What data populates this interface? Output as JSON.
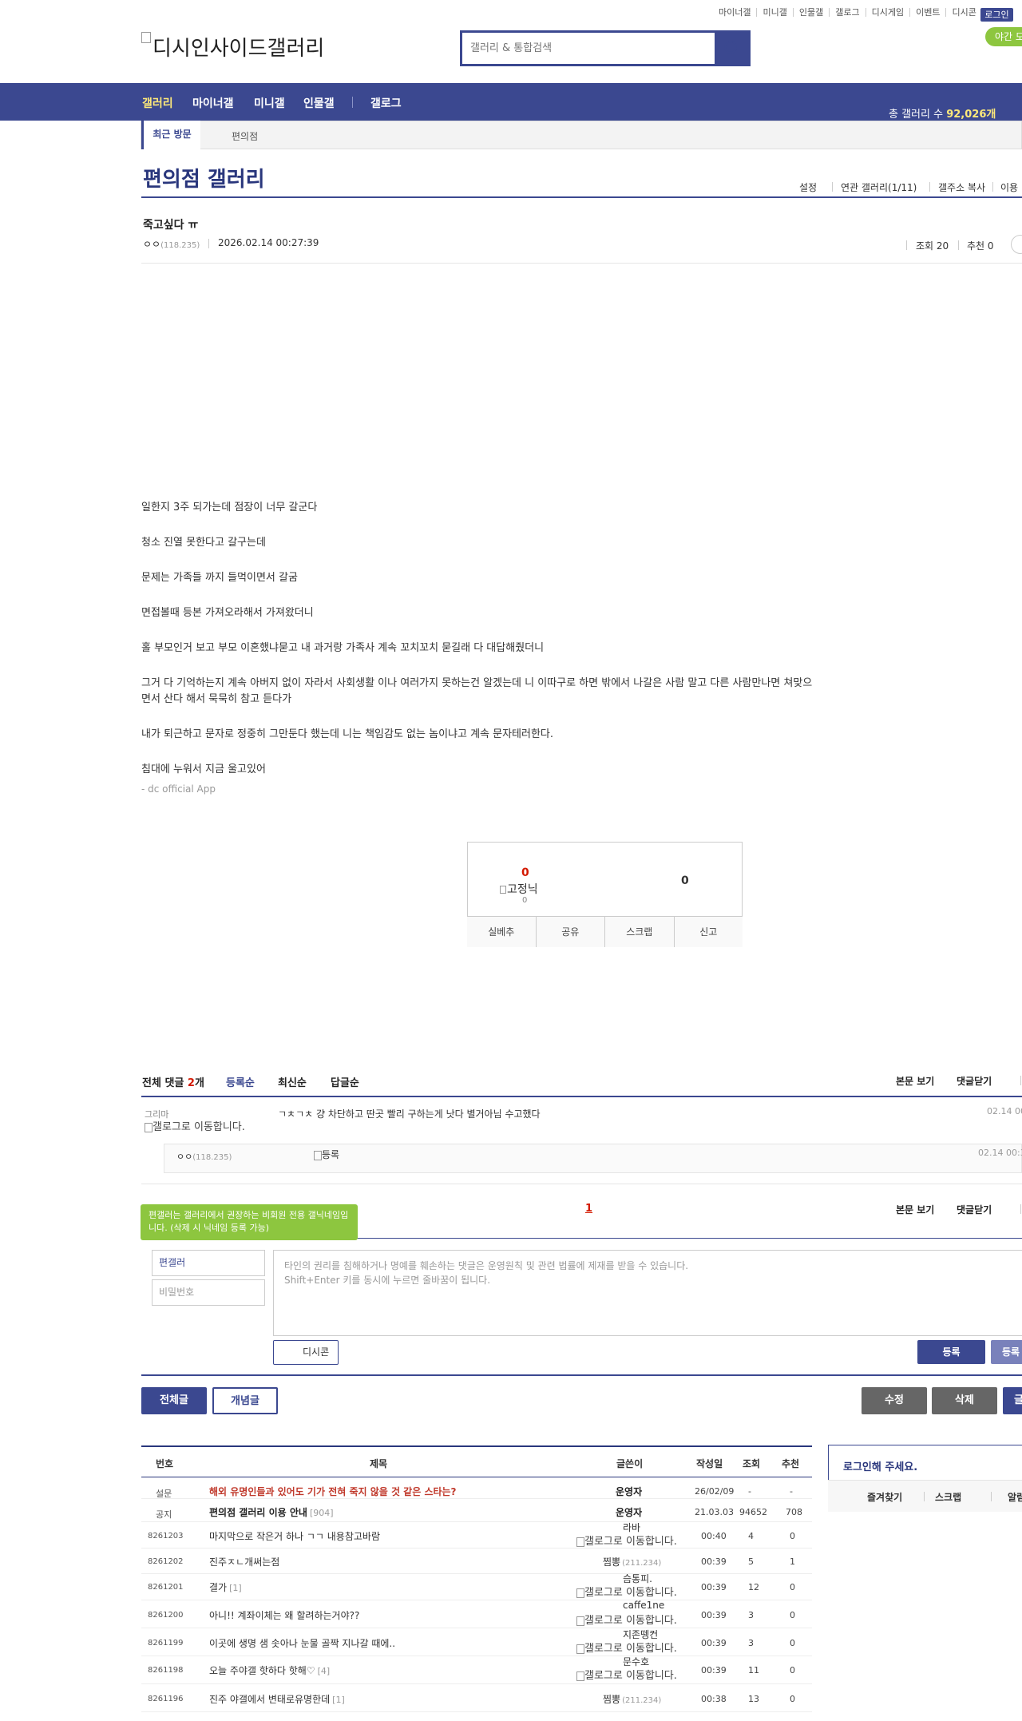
{
  "top_menu": [
    "마이너갤",
    "미니갤",
    "인물갤",
    "갤로그",
    "디시게임",
    "이벤트",
    "디시콘"
  ],
  "login_label": "로그인",
  "night_mode_label": "야간 모드",
  "logo_alt": "디시인사이드갤러리",
  "search": {
    "placeholder": "갤러리 & 통합검색"
  },
  "nav": {
    "items": [
      "갤러리",
      "마이너갤",
      "미니갤",
      "인물갤",
      "갤로그"
    ],
    "total_prefix": "총 갤러리 수",
    "total_value": "92,026개"
  },
  "recent": {
    "label": "최근 방문",
    "items": [
      "편의점"
    ]
  },
  "gallery": {
    "title": "편의점 갤러리",
    "menu": [
      "설정",
      "연관 갤러리(1/11)",
      "갤주소 복사",
      "이용"
    ]
  },
  "post": {
    "title": "죽고싶다 ㅠ",
    "author": "ㅇㅇ",
    "ip": "(118.235)",
    "date": "2026.02.14 00:27:39",
    "views_label": "조회 20",
    "recommend_label": "추천 0",
    "paragraphs": [
      "일한지 3주 되가는데 점장이 너무 갈군다",
      "청소 진열 못한다고 갈구는데",
      "문제는 가족들 까지 들먹이면서 갈굼",
      "면접볼때 등본 가져오라해서 가져왔더니",
      "홀 부모인거 보고 부모 이혼했냐묻고 내 과거랑 가족사 계속 꼬치꼬치 묻길래 다 대답해줬더니",
      "그거 다 기억하는지 계속 아버지 없이 자라서 사회생활 이나 여러가지 못하는건 알겠는데 니 이따구로 하면 밖에서 나갈은 사람 말고 다른 사람만나면 쳐맞으",
      "면서 산다 해서 묵묵히 참고 듣다가",
      "내가 퇴근하고 문자로 정중히 그만둔다 했는데  니는 책임감도 없는 놈이냐고 계속 문자테러한다.",
      "침대에 누워서 지금 울고있어"
    ],
    "app_sign": "- dc official App"
  },
  "recommend": {
    "up_count": "0",
    "fixed_label": "고정닉",
    "fixed_count": "0",
    "down_count": "0",
    "buttons": [
      "실베추",
      "공유",
      "스크랩",
      "신고"
    ]
  },
  "comments": {
    "total_label": "전체 댓글",
    "total_count": "2",
    "total_unit": "개",
    "sorts": [
      "등록순",
      "최신순",
      "답글순"
    ],
    "view_body": "본문 보기",
    "close": "댓글닫기",
    "items": [
      {
        "author": "그리마",
        "img_alt": "갤로그로 이동합니다.",
        "text": "ㄱㅊㄱㅊ 걍 차단하고 딴곳 빨리 구하는게 낫다 별거아님 수고했다",
        "date": "02.14 00:"
      },
      {
        "author": "ㅇㅇ",
        "ip": "(118.235)",
        "img_alt": "등록",
        "date": "02.14 00:3"
      }
    ],
    "page": "1"
  },
  "write": {
    "tip": "편갤러는 갤러리에서 권장하는 비회원 전용 갤닉네임입니다. (삭제 시 닉네임 등록 가능)",
    "nick": "편갤러",
    "pw_placeholder": "비밀번호",
    "notice1": "타인의 권리를 침해하거나 명예를 훼손하는 댓글은 운영원칙 및 관련 법률에 제재를 받을 수 있습니다.",
    "notice2": "Shift+Enter 키를 동시에 누르면 줄바꿈이 됩니다.",
    "dccon": "디시콘",
    "submit": "등록",
    "submit2": "등록"
  },
  "actions": {
    "all": "전체글",
    "concept": "개념글",
    "edit": "수정",
    "delete": "삭제",
    "write": "글"
  },
  "list": {
    "headers": [
      "번호",
      "제목",
      "글쓴이",
      "작성일",
      "조회",
      "추천"
    ],
    "rows": [
      {
        "no": "설문",
        "title": "해외 유명인들과 있어도 기가 전혀 죽지 않을 것 같은 스타는?",
        "author": "운영자",
        "date": "26/02/09",
        "views": "-",
        "rec": "-",
        "style": "survey"
      },
      {
        "no": "공지",
        "title": "편의점 갤러리 이용 안내",
        "count": "[904]",
        "author": "운영자",
        "date": "21.03.03",
        "views": "94652",
        "rec": "708",
        "style": "notice"
      },
      {
        "no": "8261203",
        "title": "마지막으로 작은거 하나 ㄱㄱ 내용참고바람",
        "author": "라바",
        "img": "갤로그로 이동합니다.",
        "date": "00:40",
        "views": "4",
        "rec": "0"
      },
      {
        "no": "8261202",
        "title": "진주ㅈㄴ개써는점",
        "author": "찜뽕",
        "ip": "(211.234)",
        "date": "00:39",
        "views": "5",
        "rec": "1"
      },
      {
        "no": "8261201",
        "title": "결가",
        "count": "[1]",
        "author": "슴통피.",
        "img": "갤로그로 이동합니다.",
        "date": "00:39",
        "views": "12",
        "rec": "0"
      },
      {
        "no": "8261200",
        "title": "아니!! 계좌이체는 왜 할려하는거야??",
        "author": "caffe1ne",
        "img": "갤로그로 이동합니다.",
        "date": "00:39",
        "views": "3",
        "rec": "0"
      },
      {
        "no": "8261199",
        "title": "이곳에 생명 샘 솟아나 눈물 골짝 지나갈 때에..",
        "author": "지존뗑컨",
        "img": "갤로그로 이동합니다.",
        "date": "00:39",
        "views": "3",
        "rec": "0"
      },
      {
        "no": "8261198",
        "title": "오늘 주야갤 핫하다 핫해♡",
        "count": "[4]",
        "author": "문수호",
        "img": "갤로그로 이동합니다.",
        "date": "00:39",
        "views": "11",
        "rec": "0"
      },
      {
        "no": "8261196",
        "title": "진주 야갤에서 변태로유명한데",
        "count": "[1]",
        "author": "찜뽕",
        "ip": "(211.234)",
        "date": "00:38",
        "views": "13",
        "rec": "0"
      }
    ]
  },
  "sidebox": {
    "title": "로그인해 주세요.",
    "items": [
      "즐겨찾기",
      "스크랩",
      "알림"
    ]
  },
  "colors": {
    "brand": "#3b4890",
    "accent_green": "#8dc63f",
    "highlight_yellow": "#fde97a",
    "red": "#c0392b"
  }
}
